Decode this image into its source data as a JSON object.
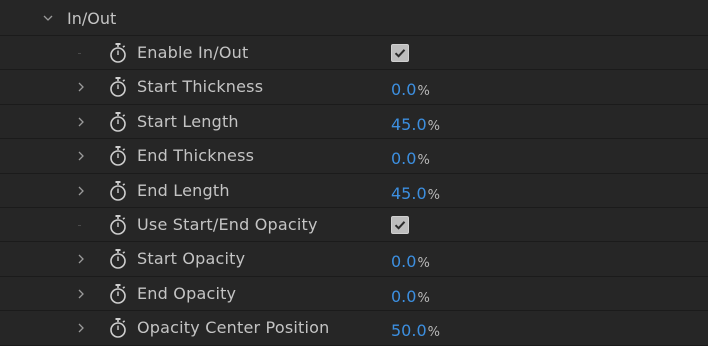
{
  "group": {
    "label": "In/Out",
    "expanded": true
  },
  "properties": [
    {
      "label": "Enable In/Out",
      "type": "checkbox",
      "checked": true,
      "expandable": false
    },
    {
      "label": "Start Thickness",
      "type": "percent",
      "value": "0.0",
      "unit": "%",
      "expandable": true
    },
    {
      "label": "Start Length",
      "type": "percent",
      "value": "45.0",
      "unit": "%",
      "expandable": true
    },
    {
      "label": "End Thickness",
      "type": "percent",
      "value": "0.0",
      "unit": "%",
      "expandable": true
    },
    {
      "label": "End Length",
      "type": "percent",
      "value": "45.0",
      "unit": "%",
      "expandable": true
    },
    {
      "label": "Use Start/End Opacity",
      "type": "checkbox",
      "checked": true,
      "expandable": false
    },
    {
      "label": "Start Opacity",
      "type": "percent",
      "value": "0.0",
      "unit": "%",
      "expandable": true
    },
    {
      "label": "End Opacity",
      "type": "percent",
      "value": "0.0",
      "unit": "%",
      "expandable": true
    },
    {
      "label": "Opacity Center Position",
      "type": "percent",
      "value": "50.0",
      "unit": "%",
      "expandable": true
    }
  ],
  "icons": {
    "group_toggle": "chevron-down-icon",
    "row_toggle": "chevron-right-icon",
    "keyframe": "stopwatch-icon",
    "check": "checkmark-icon"
  },
  "colors": {
    "background": "#262626",
    "value_blue": "#3c8fe0",
    "text": "#c4c4c4"
  }
}
